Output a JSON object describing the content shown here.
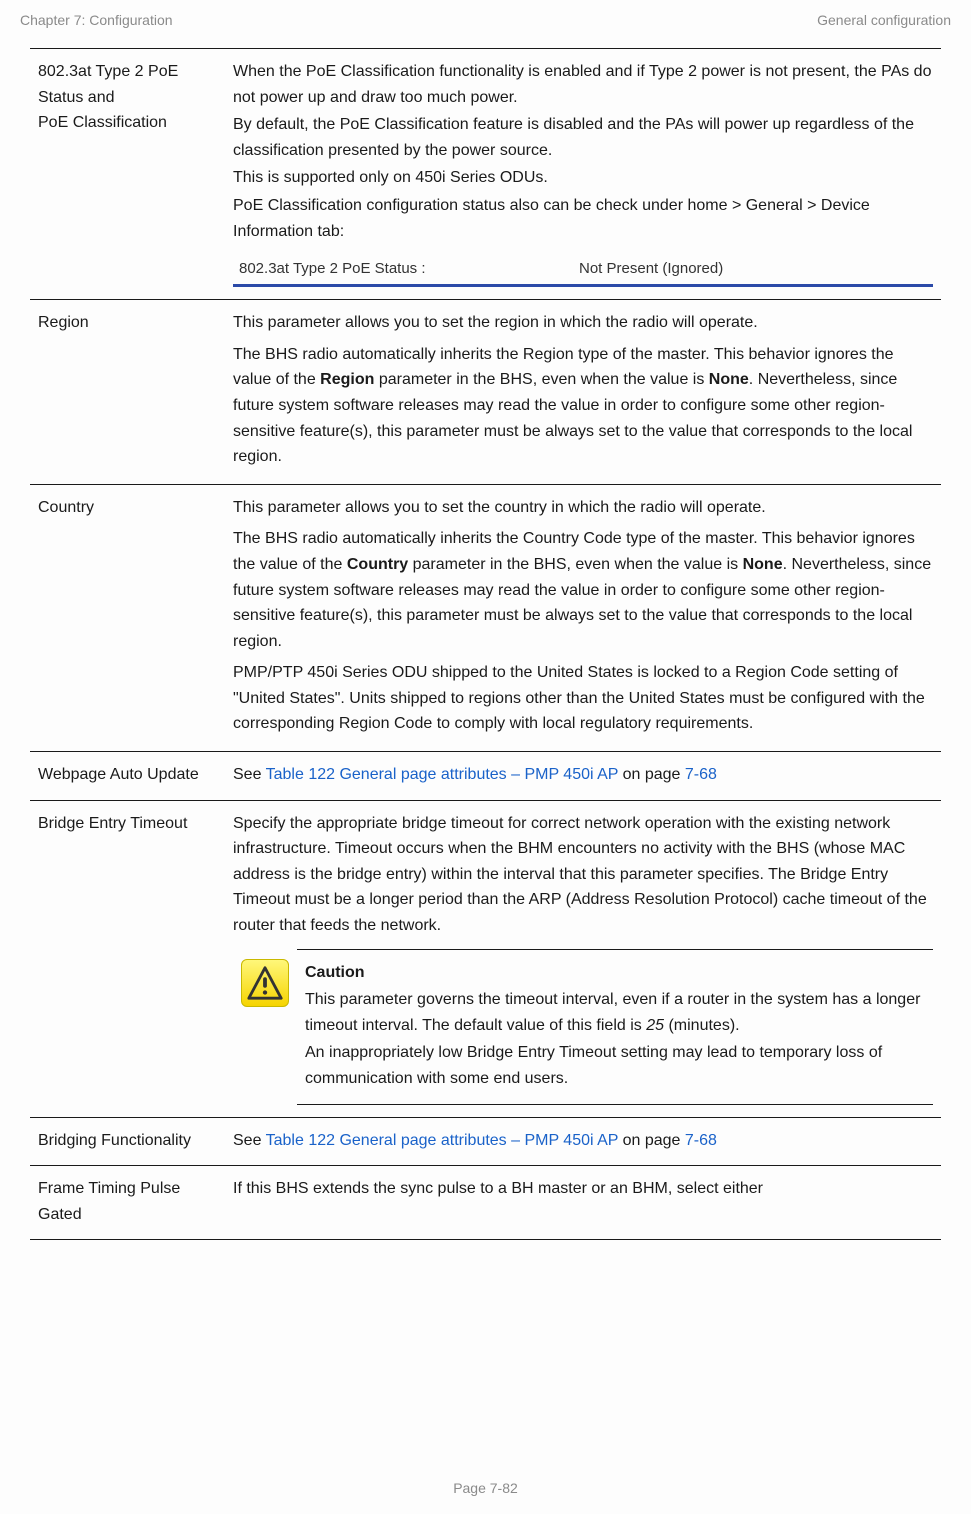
{
  "header": {
    "left": "Chapter 7:  Configuration",
    "right": "General configuration"
  },
  "rows": {
    "poe": {
      "label1": "802.3at Type 2 PoE Status and",
      "label2": "PoE Classification",
      "p1": "When the PoE Classification functionality is enabled and if Type 2 power is not present, the PAs do not power up and draw too much power.",
      "p2": "By default, the PoE Classification feature is disabled and the PAs will power up regardless of the classification presented by the power source.",
      "p3": "This is supported only on 450i Series ODUs.",
      "p4": "PoE Classification configuration status also can be check under home > General > Device Information tab:",
      "status_left": "802.3at Type 2 PoE Status :",
      "status_right": "Not Present (Ignored)"
    },
    "region": {
      "label": "Region",
      "p1": "This parameter allows you to set the region in which the radio will operate.",
      "p2a": "The BHS radio automatically inherits the Region type of the master. This behavior ignores the value of the ",
      "p2b": "Region",
      "p2c": " parameter in the BHS, even when the value is ",
      "p2d": "None",
      "p2e": ". Nevertheless, since future system software releases may read the value in order to configure some other region-sensitive feature(s), this parameter must be always set to the value that corresponds to the local region."
    },
    "country": {
      "label": "Country",
      "p1": "This parameter allows you to set the country in which the radio will operate.",
      "p2a": "The BHS radio automatically inherits the Country Code type of the master. This behavior ignores the value of the ",
      "p2b": "Country",
      "p2c": " parameter in the BHS, even when the value is ",
      "p2d": "None",
      "p2e": ". Nevertheless, since future system software releases may read the value in order to configure some other region-sensitive feature(s), this parameter must be always set to the value that corresponds to the local region.",
      "p3": "PMP/PTP 450i Series ODU shipped to the United States is locked to a Region Code setting of \"United States\". Units shipped to regions other than the United States must be configured with the corresponding Region Code to comply with local regulatory requirements."
    },
    "webpage": {
      "label": "Webpage Auto Update",
      "see": "See ",
      "link_text": "Table 122 General page attributes – PMP 450i AP",
      "on_page": " on page ",
      "page_ref": "7-68"
    },
    "bridge_timeout": {
      "label": "Bridge Entry Timeout",
      "p1": "Specify the appropriate bridge timeout for correct network operation with the existing network infrastructure. Timeout occurs when the BHM encounters no activity with the BHS (whose MAC address is the bridge entry) within the interval that this parameter specifies. The Bridge Entry Timeout must be a longer period than the ARP (Address Resolution Protocol) cache timeout of the router that feeds the network.",
      "caution_title": "Caution",
      "caution_p1a": "This parameter governs the timeout interval, even if a router in the system has a longer timeout interval. The default value of this field is ",
      "caution_p1b": "25",
      "caution_p1c": " (minutes).",
      "caution_p2": "An inappropriately low Bridge Entry Timeout setting may lead to temporary loss of communication with some end users."
    },
    "bridging_func": {
      "label": "Bridging Functionality",
      "see": "See ",
      "link_text": "Table 122 General page attributes – PMP 450i AP",
      "on_page": " on page ",
      "page_ref": "7-68"
    },
    "frame_timing": {
      "label": "Frame Timing Pulse Gated",
      "p1": "If this BHS extends the sync pulse to a BH master or an BHM, select either"
    }
  },
  "footer": {
    "page": "Page 7-82"
  }
}
